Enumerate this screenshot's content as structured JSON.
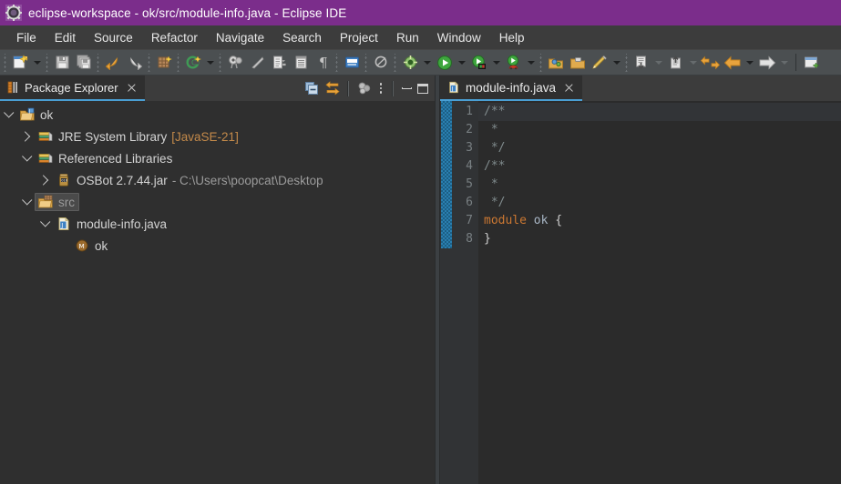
{
  "window": {
    "title": "eclipse-workspace - ok/src/module-info.java - Eclipse IDE",
    "app_icon": "eclipse-gear-icon",
    "titlebar_color": "#7b2d8b"
  },
  "menubar": {
    "items": [
      {
        "label": "File"
      },
      {
        "label": "Edit"
      },
      {
        "label": "Source"
      },
      {
        "label": "Refactor"
      },
      {
        "label": "Navigate"
      },
      {
        "label": "Search"
      },
      {
        "label": "Project"
      },
      {
        "label": "Run"
      },
      {
        "label": "Window"
      },
      {
        "label": "Help"
      }
    ]
  },
  "toolbar": {
    "groups": [
      {
        "name": "file-group",
        "buttons": [
          {
            "icon": "new-wizard-icon",
            "label": "New",
            "dropdown": true,
            "enabled": true
          }
        ]
      },
      {
        "name": "save-group",
        "buttons": [
          {
            "icon": "save-icon",
            "label": "Save",
            "dropdown": false,
            "enabled": true
          },
          {
            "icon": "save-all-icon",
            "label": "Save All",
            "dropdown": false,
            "enabled": true
          }
        ]
      },
      {
        "name": "undo-group",
        "buttons": [
          {
            "icon": "undo-arrow-icon",
            "label": "Undo",
            "dropdown": false,
            "enabled": true
          },
          {
            "icon": "redo-arrow-icon",
            "label": "Redo",
            "dropdown": false,
            "enabled": true
          }
        ]
      },
      {
        "name": "build-group",
        "buttons": [
          {
            "icon": "build-all-icon",
            "label": "Build All",
            "dropdown": false,
            "enabled": true
          },
          {
            "icon": "new-java-project-icon",
            "label": "New Java Project",
            "dropdown": true,
            "enabled": true
          }
        ]
      },
      {
        "name": "java-tools-group",
        "buttons": [
          {
            "icon": "open-type-icon",
            "label": "Open Type",
            "dropdown": false,
            "enabled": true
          },
          {
            "icon": "external-tools-icon",
            "label": "External Tools",
            "dropdown": false,
            "enabled": true
          },
          {
            "icon": "toggle-block-selection-icon",
            "label": "Toggle Block Selection",
            "dropdown": false,
            "enabled": true
          },
          {
            "icon": "show-whitespace-icon",
            "label": "Show Whitespace Characters",
            "dropdown": false,
            "enabled": true
          },
          {
            "icon": "paragraph-mark-icon",
            "label": "Paragraph Marks",
            "dropdown": false,
            "enabled": true
          }
        ]
      },
      {
        "name": "console-group",
        "buttons": [
          {
            "icon": "console-icon",
            "label": "Open Console",
            "dropdown": false,
            "enabled": true
          }
        ]
      },
      {
        "name": "search-group",
        "buttons": [
          {
            "icon": "search-icon",
            "label": "Search",
            "dropdown": false,
            "enabled": true
          }
        ]
      },
      {
        "name": "debug-run-group",
        "buttons": [
          {
            "icon": "skip-breakpoints-icon",
            "label": "Skip All Breakpoints",
            "dropdown": true,
            "enabled": true
          },
          {
            "icon": "run-icon",
            "label": "Run",
            "dropdown": true,
            "enabled": true
          },
          {
            "icon": "debug-icon",
            "label": "Debug",
            "dropdown": true,
            "enabled": true
          },
          {
            "icon": "coverage-icon",
            "label": "Coverage",
            "dropdown": true,
            "enabled": true
          }
        ]
      },
      {
        "name": "perspective-group",
        "buttons": [
          {
            "icon": "open-perspective-icon",
            "label": "Open Perspective",
            "dropdown": false,
            "enabled": true
          },
          {
            "icon": "open-folder-icon",
            "label": "Open Task",
            "dropdown": false,
            "enabled": true
          },
          {
            "icon": "highlighter-icon",
            "label": "Mylyn Highlighter",
            "dropdown": true,
            "enabled": true
          }
        ]
      },
      {
        "name": "annotation-group",
        "buttons": [
          {
            "icon": "next-annotation-icon",
            "label": "Next Annotation",
            "dropdown": true,
            "enabled": false
          },
          {
            "icon": "previous-annotation-icon",
            "label": "Previous Annotation",
            "dropdown": true,
            "enabled": false
          },
          {
            "icon": "back-forward-pair-icon",
            "label": "Last Edit Location",
            "dropdown": false,
            "enabled": true
          },
          {
            "icon": "back-arrow-icon",
            "label": "Back",
            "dropdown": true,
            "enabled": true
          },
          {
            "icon": "forward-arrow-icon",
            "label": "Forward",
            "dropdown": true,
            "enabled": false
          }
        ]
      },
      {
        "name": "view-group",
        "buttons": [
          {
            "icon": "new-window-icon",
            "label": "New Window",
            "dropdown": false,
            "enabled": true
          }
        ]
      }
    ]
  },
  "package_explorer": {
    "tab": {
      "label": "Package Explorer",
      "icon": "package-explorer-icon",
      "close_icon": "close-icon",
      "active": true,
      "underline_color": "#4a9fd4"
    },
    "view_toolbar": [
      {
        "icon": "collapse-all-icon",
        "label": "Collapse All"
      },
      {
        "icon": "link-with-editor-icon",
        "label": "Link with Editor"
      },
      {
        "icon": "view-menu-icon",
        "label": "View Menu"
      },
      {
        "icon": "kebab-menu-icon",
        "label": "View Menu"
      },
      {
        "icon": "minimize-icon",
        "label": "Minimize"
      },
      {
        "icon": "maximize-icon",
        "label": "Maximize"
      }
    ],
    "tree": [
      {
        "label": "ok",
        "icon": "java-project-icon",
        "twisty": "expanded",
        "indent": 0,
        "selected": false,
        "suffix": "",
        "suffix_style": "none"
      },
      {
        "label": "JRE System Library",
        "icon": "library-icon",
        "twisty": "collapsed",
        "indent": 1,
        "selected": false,
        "suffix": "[JavaSE-21]",
        "suffix_style": "jre"
      },
      {
        "label": "Referenced Libraries",
        "icon": "library-icon",
        "twisty": "expanded",
        "indent": 1,
        "selected": false,
        "suffix": "",
        "suffix_style": "none"
      },
      {
        "label": "OSBot 2.7.44.jar",
        "icon": "jar-icon",
        "twisty": "collapsed",
        "indent": 2,
        "selected": false,
        "suffix": "- C:\\Users\\poopcat\\Desktop",
        "suffix_style": "sub"
      },
      {
        "label": "src",
        "icon": "source-folder-icon",
        "twisty": "expanded",
        "indent": 1,
        "selected": true,
        "suffix": "",
        "suffix_style": "none"
      },
      {
        "label": "module-info.java",
        "icon": "java-file-icon",
        "twisty": "expanded",
        "indent": 2,
        "selected": false,
        "suffix": "",
        "suffix_style": "none"
      },
      {
        "label": "ok",
        "icon": "module-icon",
        "twisty": "none",
        "indent": 3,
        "selected": false,
        "suffix": "",
        "suffix_style": "none"
      }
    ]
  },
  "editor": {
    "tab": {
      "label": "module-info.java",
      "icon": "java-file-icon",
      "close_icon": "close-icon",
      "active": true,
      "underline_color": "#4a9fd4"
    },
    "change_bar_color": "#2a7fb0",
    "current_line": 1,
    "lines": [
      {
        "number": "1",
        "tokens": [
          {
            "text": "/**",
            "type": "comment"
          }
        ]
      },
      {
        "number": "2",
        "tokens": [
          {
            "text": " *",
            "type": "comment"
          }
        ]
      },
      {
        "number": "3",
        "tokens": [
          {
            "text": " */",
            "type": "comment"
          }
        ]
      },
      {
        "number": "4",
        "tokens": [
          {
            "text": "/**",
            "type": "comment"
          }
        ]
      },
      {
        "number": "5",
        "tokens": [
          {
            "text": " *",
            "type": "comment"
          }
        ]
      },
      {
        "number": "6",
        "tokens": [
          {
            "text": " */",
            "type": "comment"
          }
        ]
      },
      {
        "number": "7",
        "tokens": [
          {
            "text": "module",
            "type": "keyword"
          },
          {
            "text": " ok ",
            "type": "plain"
          },
          {
            "text": "{",
            "type": "brace"
          }
        ]
      },
      {
        "number": "8",
        "tokens": [
          {
            "text": "}",
            "type": "brace"
          }
        ]
      }
    ]
  }
}
